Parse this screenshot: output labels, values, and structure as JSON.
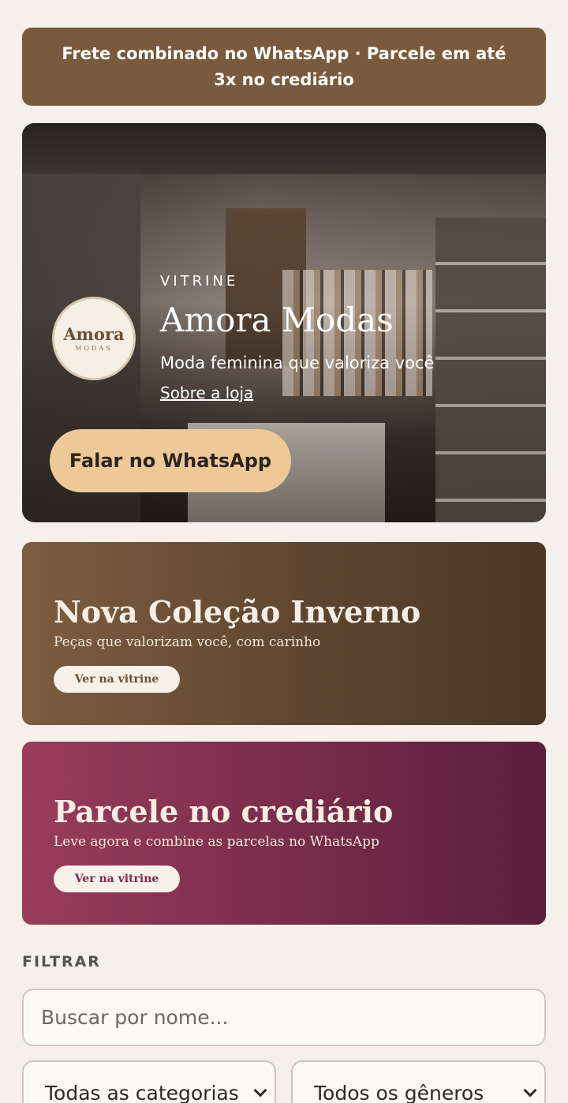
{
  "promo": {
    "text": "Frete combinado no WhatsApp · Parcele em até 3x no crediário"
  },
  "hero": {
    "logo_name": "Amora",
    "logo_sub": "MODAS",
    "eyebrow": "VITRINE",
    "title": "Amora Modas",
    "subtitle": "Moda feminina que valoriza você",
    "about_link": "Sobre a loja",
    "whatsapp_button": "Falar no WhatsApp"
  },
  "banners": [
    {
      "title": "Nova Coleção Inverno",
      "text": "Peças que valorizam você, com carinho",
      "button": "Ver na vitrine",
      "color": "#6b4d35"
    },
    {
      "title": "Parcele no crediário",
      "text": "Leve agora e combine as parcelas no WhatsApp",
      "button": "Ver na vitrine",
      "color": "#7a2d4a"
    }
  ],
  "filter": {
    "heading": "FILTRAR",
    "search_placeholder": "Buscar por nome...",
    "category_selected": "Todas as categorias",
    "gender_selected": "Todos os gêneros"
  },
  "colors": {
    "background": "#f5f0eb",
    "brand_brown": "#7a5a3c",
    "accent_gold": "#ecc997"
  }
}
